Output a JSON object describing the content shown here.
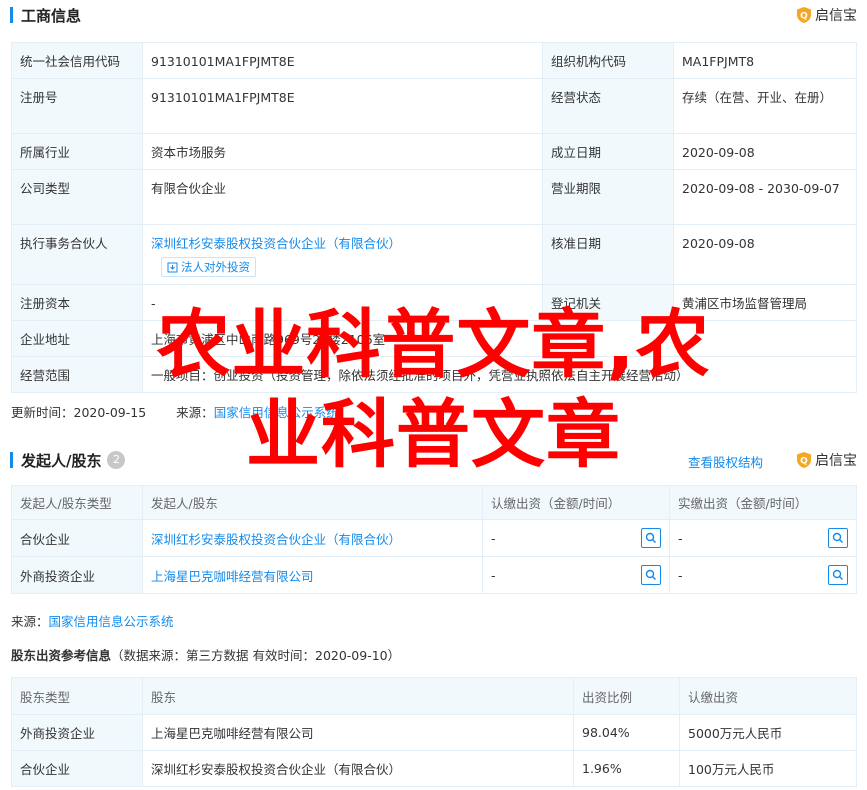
{
  "business_info": {
    "title": "工商信息",
    "logo_text": "启信宝",
    "rows": [
      {
        "l1": "统一社会信用代码",
        "v1": "91310101MA1FPJMT8E",
        "l2": "组织机构代码",
        "v2": "MA1FPJMT8"
      },
      {
        "l1": "注册号",
        "v1": "91310101MA1FPJMT8E",
        "l2": "经营状态",
        "v2": "存续（在营、开业、在册）"
      },
      {
        "l1": "所属行业",
        "v1": "资本市场服务",
        "l2": "成立日期",
        "v2": "2020-09-08"
      },
      {
        "l1": "公司类型",
        "v1": "有限合伙企业",
        "l2": "营业期限",
        "v2": "2020-09-08 - 2030-09-07"
      },
      {
        "l1": "执行事务合伙人",
        "v1": "深圳红杉安泰股权投资合伙企业（有限合伙）",
        "v1_button": "法人对外投资",
        "l2": "核准日期",
        "v2": "2020-09-08"
      },
      {
        "l1": "注册资本",
        "v1": "-",
        "l2": "登记机关",
        "v2": "黄浦区市场监督管理局"
      },
      {
        "l1": "企业地址",
        "v1": "上海市黄浦区中山南路969号21楼2106室"
      },
      {
        "l1": "经营范围",
        "v1": "一般项目：创业投资（投资管理，除依法须经批准的项目外，凭营业执照依法自主开展经营活动）"
      }
    ],
    "updated_label": "更新时间：",
    "updated_value": "2020-09-15",
    "source_label": "来源：",
    "source_value": "国家信用信息公示系统"
  },
  "shareholders": {
    "title": "发起人/股东",
    "count": "2",
    "equity_link": "查看股权结构",
    "logo_text": "启信宝",
    "headers": [
      "发起人/股东类型",
      "发起人/股东",
      "认缴出资（金额/时间）",
      "实缴出资（金额/时间）"
    ],
    "rows": [
      {
        "type": "合伙企业",
        "name": "深圳红杉安泰股权投资合伙企业（有限合伙）",
        "subscribed": "-",
        "paid": "-"
      },
      {
        "type": "外商投资企业",
        "name": "上海星巴克咖啡经营有限公司",
        "subscribed": "-",
        "paid": "-"
      }
    ],
    "source_label": "来源：",
    "source_value": "国家信用信息公示系统"
  },
  "reference": {
    "title": "股东出资参考信息",
    "subtitle": "（数据来源：第三方数据 有效时间：2020-09-10）",
    "headers": [
      "股东类型",
      "股东",
      "出资比例",
      "认缴出资"
    ],
    "rows": [
      {
        "type": "外商投资企业",
        "name": "上海星巴克咖啡经营有限公司",
        "ratio": "98.04%",
        "amount": "5000万元人民币"
      },
      {
        "type": "合伙企业",
        "name": "深圳红杉安泰股权投资合伙企业（有限合伙）",
        "ratio": "1.96%",
        "amount": "100万元人民币"
      }
    ]
  },
  "overlay": {
    "line1": "农业科普文章,农",
    "line2": "业科普文章"
  },
  "colors": {
    "accent": "#128bed",
    "label_bg": "#f2f9fc",
    "border": "#e4eef6",
    "overlay": "#ff0000",
    "logo": "#f5a623"
  }
}
